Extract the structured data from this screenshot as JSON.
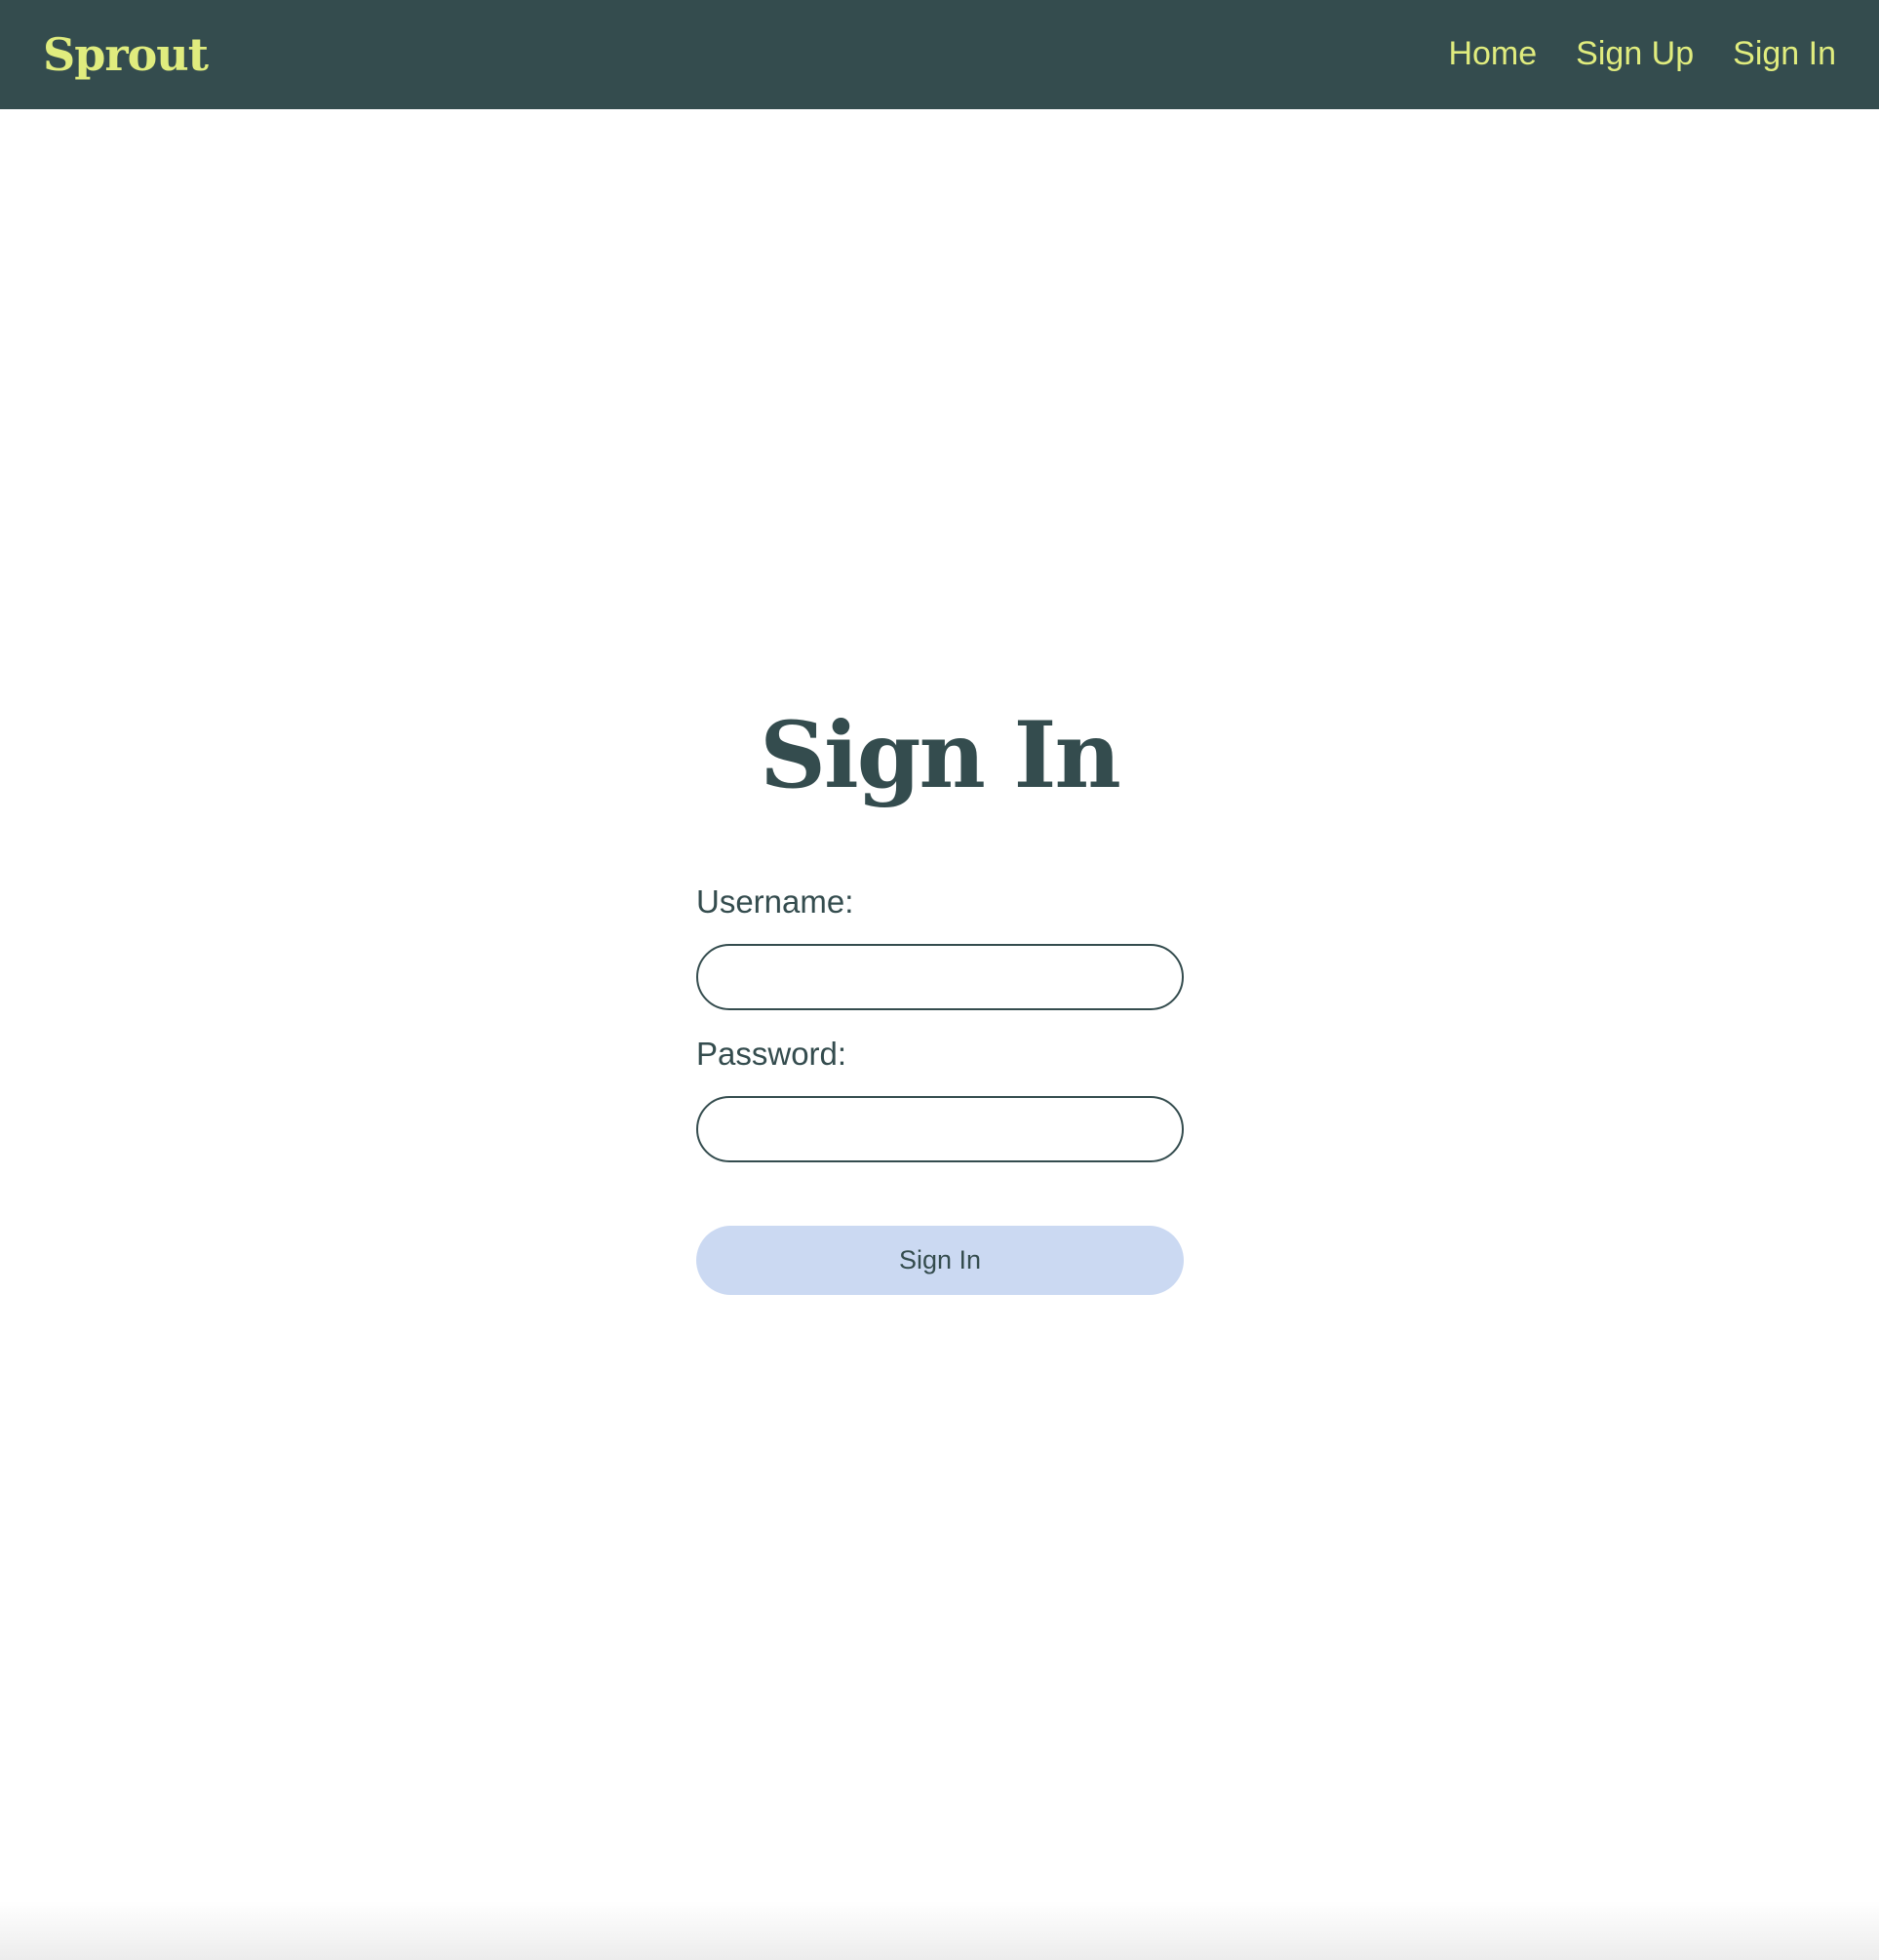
{
  "navbar": {
    "brand": "Sprout",
    "links": [
      {
        "label": "Home"
      },
      {
        "label": "Sign Up"
      },
      {
        "label": "Sign In"
      }
    ]
  },
  "form": {
    "title": "Sign In",
    "username": {
      "label": "Username:",
      "value": "",
      "placeholder": ""
    },
    "password": {
      "label": "Password:",
      "value": "",
      "placeholder": ""
    },
    "submit_label": "Sign In"
  },
  "colors": {
    "navbar_bg": "#344c4e",
    "accent": "#e0ec7e",
    "text": "#344c4e",
    "button_bg": "#cbd9f2"
  }
}
